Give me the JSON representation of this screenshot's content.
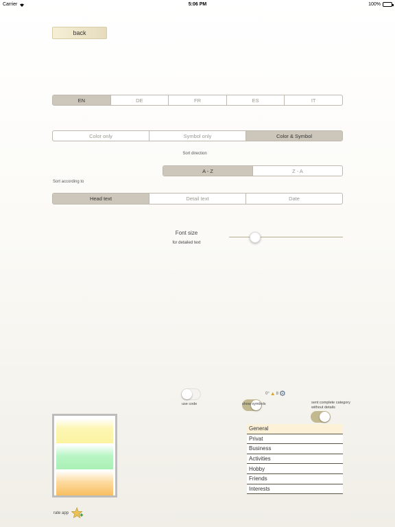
{
  "status_bar": {
    "carrier": "Carrier",
    "time": "5:06 PM",
    "battery": "100%"
  },
  "back_button": "back",
  "languages": {
    "options": [
      "EN",
      "DE",
      "FR",
      "ES",
      "IT"
    ],
    "selected": "EN"
  },
  "display_mode": {
    "options": [
      "Color only",
      "Symbol only",
      "Color & Symbol"
    ],
    "selected": "Color & Symbol"
  },
  "sort_direction": {
    "label": "Sort direction",
    "options": [
      "A - Z",
      "Z - A"
    ],
    "selected": "A - Z"
  },
  "sort_by": {
    "label": "Sort according to",
    "options": [
      "Head text",
      "Detail text",
      "Date"
    ],
    "selected": "Head text"
  },
  "font_size": {
    "label": "Font size",
    "sublabel": "for detailed text",
    "value_fraction": 0.2
  },
  "toggles": {
    "use_code": {
      "label": "use code",
      "on": false
    },
    "show_symbols": {
      "label": "show symbols",
      "on": true,
      "sample_text": "0°",
      "sample_text2": "8"
    },
    "sent_complete": {
      "label": "sent complete category without details",
      "on": true
    }
  },
  "categories": {
    "items": [
      "General",
      "Privat",
      "Business",
      "Activities",
      "Hobby",
      "Friends",
      "Interests"
    ],
    "selected": "General"
  },
  "rate_app": {
    "label": "rate app"
  },
  "colors": {
    "selected_segment": "#cdc7bb",
    "toggle_on": "#c3b990",
    "back_button": "#efe6c8",
    "category_selected": "#fdf1d8"
  }
}
